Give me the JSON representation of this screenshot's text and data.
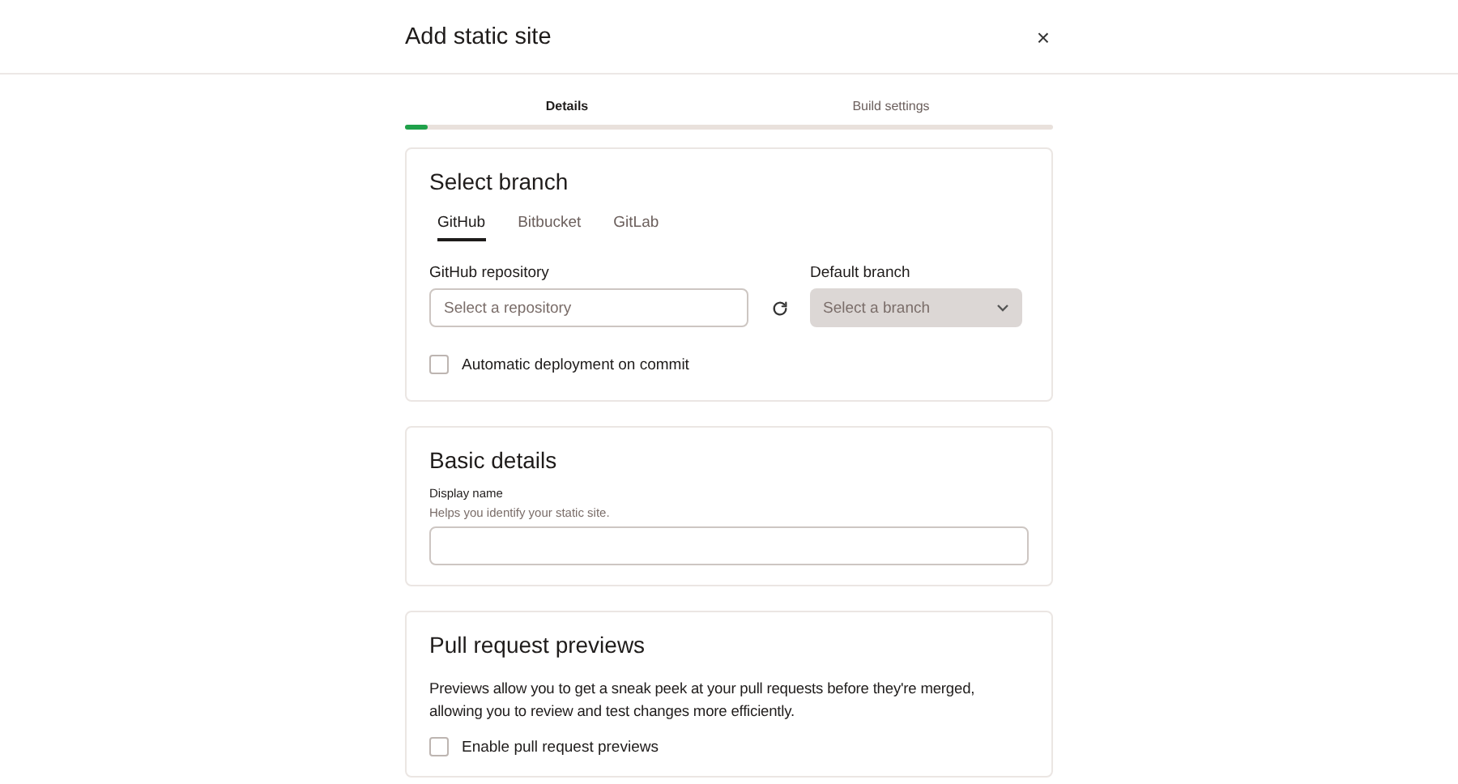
{
  "dialog": {
    "title": "Add static site",
    "close": "×"
  },
  "steps": [
    {
      "label": "Details",
      "selected": true
    },
    {
      "label": "Build settings",
      "selected": false
    }
  ],
  "progress": {
    "level": 0.035
  },
  "select_branch": {
    "title": "Select branch",
    "tabs": [
      {
        "label": "GitHub",
        "selected": true
      },
      {
        "label": "Bitbucket",
        "selected": false
      },
      {
        "label": "GitLab",
        "selected": false
      }
    ],
    "repository": {
      "label": "GitHub repository",
      "placeholder": "Select a repository"
    },
    "branch": {
      "label": "Default branch",
      "placeholder": "Select a branch",
      "disabled": true
    },
    "auto_deploy": {
      "label": "Automatic deployment on commit",
      "checked": false
    }
  },
  "basic_details": {
    "title": "Basic details",
    "field": {
      "label": "Display name",
      "hint": "Helps you identify your static site."
    }
  },
  "pull_request_previews": {
    "title": "Pull request previews",
    "description": "Previews allow you to get a sneak peek at your pull requests before they're merged, allowing you to review and test changes more efficiently.",
    "enable": {
      "label": "Enable pull request previews",
      "checked": false
    }
  }
}
